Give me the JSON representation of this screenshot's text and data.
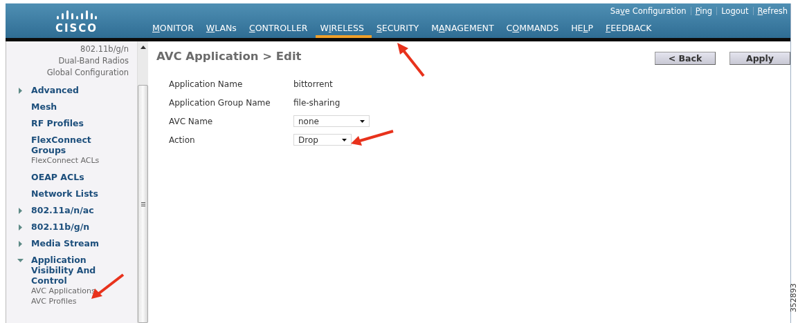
{
  "header": {
    "logo": "CISCO",
    "top_links": [
      {
        "before": "Sa",
        "key": "v",
        "after": "e Configuration"
      },
      {
        "key": "P",
        "after": "ing"
      },
      {
        "before": "Lo",
        "key": "g",
        "after": "out"
      },
      {
        "key": "R",
        "after": "efresh"
      }
    ],
    "nav": [
      {
        "key": "M",
        "after": "ONITOR",
        "selected": false
      },
      {
        "key": "W",
        "after": "LANs",
        "selected": false
      },
      {
        "key": "C",
        "after": "ONTROLLER",
        "selected": false
      },
      {
        "before": "W",
        "key": "I",
        "after": "RELESS",
        "selected": true
      },
      {
        "key": "S",
        "after": "ECURITY",
        "selected": false
      },
      {
        "before": "M",
        "key": "A",
        "after": "NAGEMENT",
        "selected": false
      },
      {
        "before": "C",
        "key": "O",
        "after": "MMANDS",
        "selected": false
      },
      {
        "before": "HE",
        "key": "L",
        "after": "P",
        "selected": false
      },
      {
        "key": "F",
        "after": "EEDBACK",
        "selected": false
      }
    ]
  },
  "sidebar": {
    "items": [
      {
        "kind": "link",
        "label": "802.11b/g/n"
      },
      {
        "kind": "link",
        "label": "Dual-Band Radios"
      },
      {
        "kind": "link",
        "label": "Global Configuration"
      },
      {
        "kind": "section",
        "label": "Advanced",
        "expanded": false
      },
      {
        "kind": "section",
        "label": "Mesh"
      },
      {
        "kind": "section",
        "label": "RF Profiles"
      },
      {
        "kind": "section",
        "label": "FlexConnect Groups",
        "children": [
          {
            "label": "FlexConnect ACLs"
          }
        ]
      },
      {
        "kind": "section",
        "label": "OEAP ACLs"
      },
      {
        "kind": "section",
        "label": "Network Lists"
      },
      {
        "kind": "section",
        "label": "802.11a/n/ac",
        "expanded": false
      },
      {
        "kind": "section",
        "label": "802.11b/g/n",
        "expanded": false
      },
      {
        "kind": "section",
        "label": "Media Stream",
        "expanded": false
      },
      {
        "kind": "section",
        "label": "Application Visibility And Control",
        "expanded": true,
        "children": [
          {
            "label": "AVC Applications"
          },
          {
            "label": "AVC Profiles"
          }
        ]
      }
    ]
  },
  "page": {
    "title": "AVC Application > Edit",
    "buttons": [
      "< Back",
      "Apply"
    ],
    "fields": [
      {
        "kind": "text",
        "label": "Application Name",
        "value": "bittorrent"
      },
      {
        "kind": "text",
        "label": "Application Group Name",
        "value": "file-sharing"
      },
      {
        "kind": "select",
        "label": "AVC Name",
        "value": "none"
      },
      {
        "kind": "select",
        "label": "Action",
        "value": "Drop"
      }
    ]
  },
  "figure_id": "352893"
}
